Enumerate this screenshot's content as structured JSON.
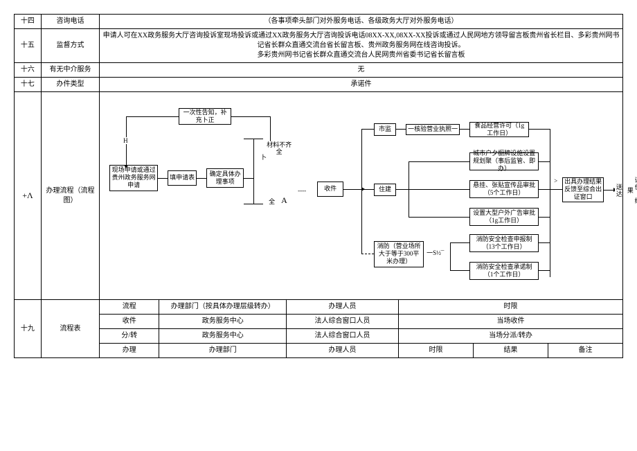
{
  "rows": {
    "r14": {
      "num": "十四",
      "label": "咨询电话",
      "value": "（各事项牵头部门对外服务电话、各级政务大厅对外服务电话）"
    },
    "r15": {
      "num": "十五",
      "label": "监督方式",
      "value": "申请人可在XX政务服务大厅咨询投诉室现场投诉或通过XX政务服务大厅咨询投诉电话08XX-XX,08XX-XX投诉或通过人民网地方领导留言板贵州省长栏目、多彩贵州网书记省长群众直通交流台省长留言板、贵州政务服务网在线咨询投诉。\n多彩贵州网书记省长群众直通交流台人民网贵州省委书记省长留言板"
    },
    "r16": {
      "num": "十六",
      "label": "有无中介服务",
      "value": "无"
    },
    "r17": {
      "num": "十七",
      "label": "办件类型",
      "value": "承诺件"
    },
    "r18": {
      "num": "+Λ",
      "label": "办理流程（流程图）"
    },
    "r19": {
      "num": "十九",
      "label": "流程表"
    }
  },
  "flow": {
    "b_apply": "现场申请或通过贵州政务服务网申请",
    "b_form": "填申请表",
    "b_confirm": "确定具体办理事项",
    "b_once": "一次性告知，补充卜正",
    "t_incomplete": "材料不齐全",
    "t_complete": "全",
    "t_A": "A",
    "t_dots": "----",
    "b_receive": "收件",
    "b_shijian": "市监",
    "b_license": "一核验营业执照一",
    "b_food": "食品经营许可（1g工作日）",
    "b_zhujian": "住建",
    "b_signboard": "城市户夕橱牌设施设置规划聚（事后监管、即办）",
    "b_poster": "悬挂、张贴宣传品审批（5个工作日）",
    "b_outdoor": "设置大型户外广告审批（1g工作日）",
    "b_fire": "消防（营业场所大于等于300平米办理）",
    "t_s": "一S½¯",
    "b_firecheck1": "消防安全检查申报制（13个工作日）",
    "b_firecheck2": "消防安全检查承诺制（1个工作日）",
    "t_gt": ">",
    "b_result": "出具办理结果反馈至综合出证窗口",
    "t_send": "送达",
    "t_eval": "评价、结果",
    "t_tick": "卜",
    "t_H": "H"
  },
  "table19": {
    "h_flow": "流程",
    "h_dept": "办理部门（按具体办理层级转办）",
    "h_staff": "办理人员",
    "h_time": "时限",
    "h_result": "结果",
    "h_note": "备注",
    "row1": {
      "c1": "收件",
      "c2": "政务服务中心",
      "c3": "法人综合窗口人员",
      "c4": "当场收件"
    },
    "row2": {
      "c1": "分/转",
      "c2": "政务服务中心",
      "c3": "法人综合窗口人员",
      "c4": "当场分派/转办"
    },
    "row3": {
      "c1": "办理",
      "c2": "办理部门",
      "c3": "办理人员",
      "c4": "时限",
      "c5": "结果",
      "c6": "备注"
    }
  }
}
